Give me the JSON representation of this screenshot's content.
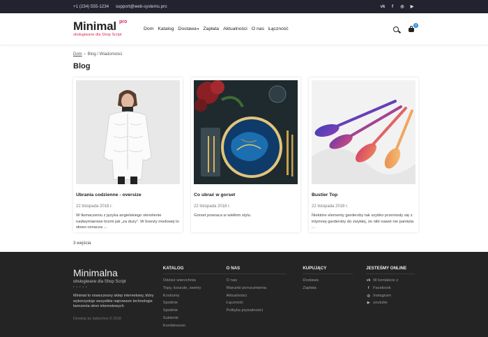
{
  "topbar": {
    "phone": "+1 (234) 555-1234",
    "email": "support@web-systems.pro",
    "social": [
      {
        "icon": "vk-icon",
        "glyph": "vk"
      },
      {
        "icon": "facebook-icon",
        "glyph": "f"
      },
      {
        "icon": "instagram-icon",
        "glyph": "◎"
      },
      {
        "icon": "youtube-icon",
        "glyph": "▶"
      }
    ]
  },
  "header": {
    "logo": {
      "name": "Minimal",
      "pro": "pro",
      "tagline": "obsługiwane dla Shop Script"
    },
    "nav": [
      {
        "label": "Dom"
      },
      {
        "label": "Katalog"
      },
      {
        "label": "Dostawa",
        "caret": "▾"
      },
      {
        "label": "Zapłata"
      },
      {
        "label": "Aktualności"
      },
      {
        "label": "O nas"
      },
      {
        "label": "Łączność"
      }
    ],
    "cart_count": "0"
  },
  "breadcrumb": {
    "home": "Dom",
    "separator": "›",
    "current": "Blog / Wiadomości"
  },
  "page_title": "Blog",
  "posts": [
    {
      "title": "Ubrania codzienne - oversize",
      "date": "22 listopada 2018 r.",
      "excerpt": "W tłumaczeniu z języka angielskiego określenie nadwymiarowe brzmi jak „za duży”. W branży modowej to słowo oznacza ..."
    },
    {
      "title": "Co ubrać w gorset",
      "date": "22 listopada 2018 r.",
      "excerpt": "Gorset powraca w wielkim stylu."
    },
    {
      "title": "Bustier Top",
      "date": "22 listopada 2018 r.",
      "excerpt": "Niektóre elementy garderoby tak szybko przeniosły się z intymnej garderoby do zwykłej, że nikt nawet nie pamięta ..."
    }
  ],
  "entries_count": "3 wejścia",
  "footer": {
    "brand": {
      "name": "Minimalna",
      "tagline": "obsługiwane dla Shop Script",
      "stars": "• • • • •",
      "description": "Minimal to nowoczesny sklep internetowy, który wykorzystuje wszystkie najnowsze technologie tworzenia stron internetowych",
      "copyright": "Develop by Iadurchno © 2018"
    },
    "columns": [
      {
        "head": "KATALOG",
        "items": [
          "Odzież wierzchnia",
          "Topy, koszule, swetry",
          "Kostiumy",
          "Spodnie",
          "Spodnie",
          "Sukienki",
          "Kombinezon"
        ]
      },
      {
        "head": "O NAS",
        "items": [
          "O nas",
          "Warunki porozumienia",
          "Aktualności",
          "Łączność",
          "Polityka prywatności"
        ]
      },
      {
        "head": "KUPUJĄCY",
        "items": [
          "Dostawa",
          "Zapłata"
        ]
      },
      {
        "head": "JESTEŚMY ONLINE",
        "items": [
          {
            "label": "W kontakcie z",
            "icon": "vk-icon",
            "glyph": "vk"
          },
          {
            "label": "Facebook",
            "icon": "facebook-icon",
            "glyph": "f"
          },
          {
            "label": "Instagram",
            "icon": "instagram-icon",
            "glyph": "◎"
          },
          {
            "label": "youtube",
            "icon": "youtube-icon",
            "glyph": "▶"
          }
        ]
      }
    ]
  },
  "colors": {
    "accent": "#d62c55",
    "badge": "#2d8ad6",
    "dark": "#242424",
    "topbar": "#23232f"
  }
}
